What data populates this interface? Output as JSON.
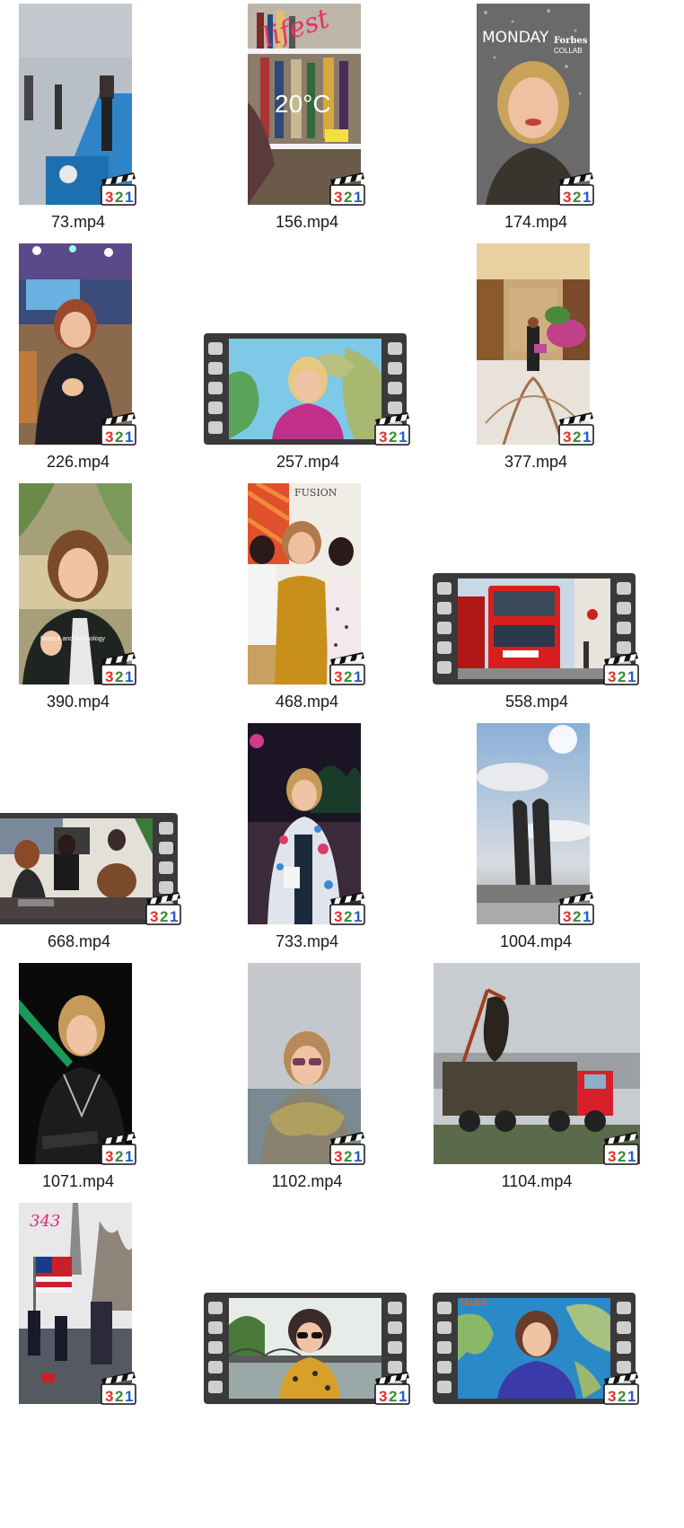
{
  "files": [
    {
      "name": "73.mp4",
      "kind": "portrait",
      "scene": "expo-hall"
    },
    {
      "name": "156.mp4",
      "kind": "portrait",
      "scene": "bookshelf",
      "overlay": [
        "lifest",
        "20°C"
      ]
    },
    {
      "name": "174.mp4",
      "kind": "portrait",
      "scene": "selfie-sparkle",
      "overlay": [
        "MONDAY",
        "Forbes",
        "COLLAB"
      ]
    },
    {
      "name": "226.mp4",
      "kind": "portrait",
      "scene": "stage-lights"
    },
    {
      "name": "257.mp4",
      "kind": "landscape",
      "scene": "world-map-magenta"
    },
    {
      "name": "377.mp4",
      "kind": "portrait",
      "scene": "marble-lobby"
    },
    {
      "name": "390.mp4",
      "kind": "portrait",
      "scene": "palm-talk",
      "overlay": [
        "finance and technology"
      ]
    },
    {
      "name": "468.mp4",
      "kind": "portrait",
      "scene": "group-fusion",
      "overlay": [
        "FUSION"
      ]
    },
    {
      "name": "558.mp4",
      "kind": "landscape",
      "scene": "red-bus"
    },
    {
      "name": "668.mp4",
      "kind": "landscape",
      "scene": "makeup-room"
    },
    {
      "name": "733.mp4",
      "kind": "portrait",
      "scene": "night-party"
    },
    {
      "name": "1004.mp4",
      "kind": "portrait",
      "scene": "sculpture-sky"
    },
    {
      "name": "1071.mp4",
      "kind": "portrait",
      "scene": "dark-stage"
    },
    {
      "name": "1102.mp4",
      "kind": "portrait",
      "scene": "scarf-sea"
    },
    {
      "name": "1104.mp4",
      "kind": "landscape-wide",
      "scene": "truck-eagle"
    },
    {
      "name": "",
      "kind": "portrait",
      "scene": "parade",
      "overlay": [
        "343"
      ]
    },
    {
      "name": "",
      "kind": "landscape",
      "scene": "bridge-river"
    },
    {
      "name": "",
      "kind": "landscape",
      "scene": "map-blue",
      "overlay": [
        "TALKS"
      ]
    }
  ],
  "badge_text": "321",
  "colors": {
    "label": "#1a1a1a",
    "background": "#ffffff"
  }
}
